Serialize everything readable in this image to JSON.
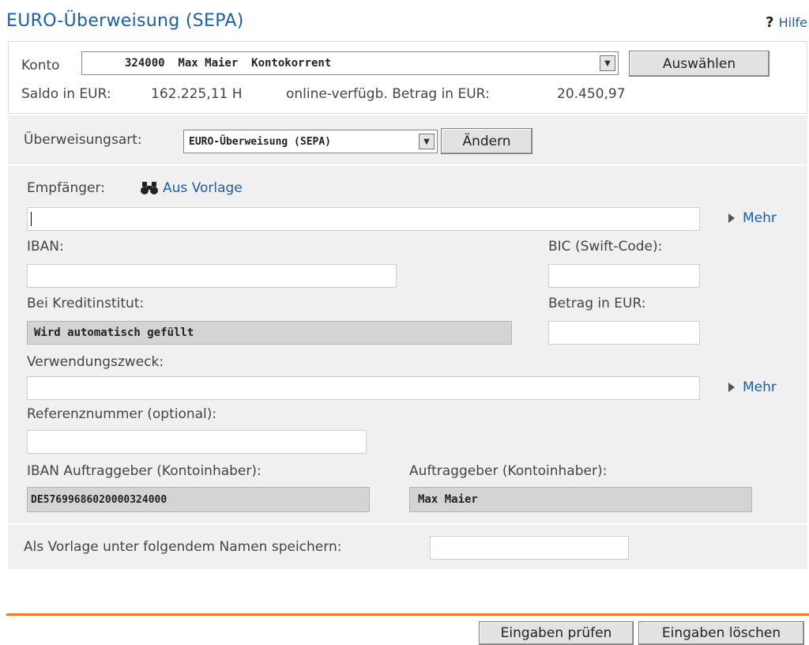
{
  "header": {
    "title": "EURO-Überweisung (SEPA)",
    "help_label": "Hilfe",
    "help_icon": "question-icon"
  },
  "konto": {
    "label": "Konto",
    "selected": "324000  Max Maier  Kontokorrent",
    "select_button": "Auswählen",
    "saldo_label": "Saldo in EUR:",
    "saldo_value": "162.225,11 H",
    "available_label": "online-verfügb. Betrag in EUR:",
    "available_value": "20.450,97"
  },
  "transfer_type": {
    "label": "Überweisungsart:",
    "selected": "EURO-Überweisung (SEPA)",
    "change_button": "Ändern"
  },
  "form": {
    "recipient_label": "Empfänger:",
    "from_template_label": "Aus Vorlage",
    "more_label": "Mehr",
    "iban_label": "IBAN:",
    "bic_label": "BIC (Swift-Code):",
    "bank_label": "Bei Kreditinstitut:",
    "bank_value": "Wird automatisch gefüllt",
    "amount_label": "Betrag in EUR:",
    "purpose_label": "Verwendungszweck:",
    "reference_label": "Referenznummer (optional):",
    "payer_iban_label": "IBAN Auftraggeber (Kontoinhaber):",
    "payer_iban_value": "DE57699686020000324000",
    "payer_label": "Auftraggeber (Kontoinhaber):",
    "payer_value": "Max Maier"
  },
  "template": {
    "save_label": "Als Vorlage unter folgendem Namen speichern:"
  },
  "actions": {
    "check": "Eingaben prüfen",
    "clear": "Eingaben löschen"
  },
  "colors": {
    "accent": "#1a5fa8",
    "divider": "#f07a1e",
    "panel": "#f0f0f0"
  }
}
